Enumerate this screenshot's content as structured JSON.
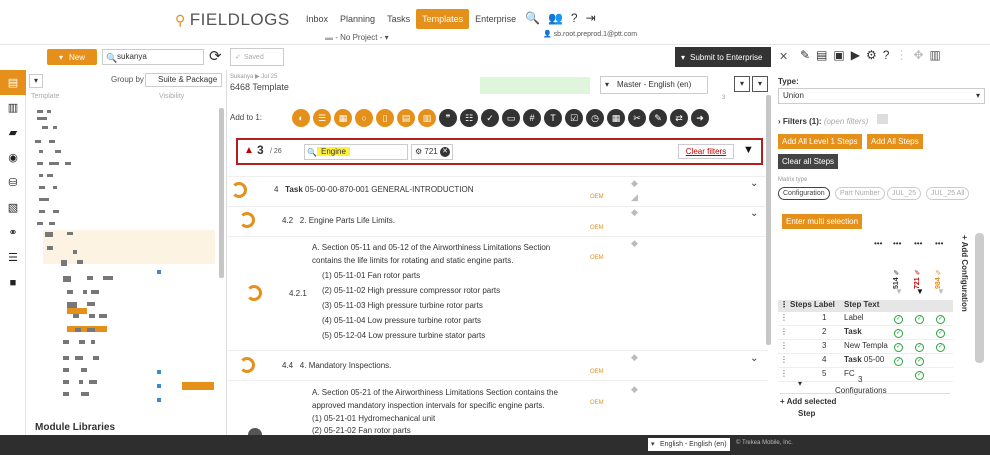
{
  "header": {
    "logo": "FIELDLOGS",
    "nav": [
      "Inbox",
      "Planning",
      "Tasks",
      "Templates",
      "Enterprise"
    ],
    "active_nav": "Templates",
    "project": "- No Project -",
    "user_email": "sb.root.preprod.1@ptt.com"
  },
  "toolbar": {
    "new_label": "New",
    "search_value": "sukanya",
    "saved_label": "Saved",
    "submit_label": "Submit to Enterprise"
  },
  "templates_panel": {
    "group_by_label": "Group by",
    "group_by_value": "Suite & Package",
    "col_template": "Template",
    "col_visibility": "Visibility",
    "module_libraries": "Module Libraries"
  },
  "content": {
    "breadcrumb": "Sukanya ▶ Jul 25",
    "template_name": "6468 Template",
    "language": "Master - English (en)",
    "page_indicator": "3",
    "add_to_label": "Add to 1:"
  },
  "filter_bar": {
    "count": "3",
    "total": "/ 26",
    "filter_text": "Engine",
    "chip_value": "721",
    "clear_label": "Clear filters"
  },
  "steps": [
    {
      "num": "4",
      "bold": "Task",
      "text": "05-00-00-870-001 GENERAL-INTRODUCTION",
      "oem": "OEM"
    },
    {
      "num": "4.2",
      "text": "2. Engine Parts Life Limits.",
      "oem": "OEM"
    },
    {
      "num": "4.2.1",
      "lines": [
        "A. Section 05-11 and 05-12 of the Airworthiness Limitations Section",
        "contains the life limits for rotating and static engine parts.",
        "(1) 05-11-01 Fan rotor parts",
        "(2) 05-11-02 High pressure compressor rotor parts",
        "(3) 05-11-03 High pressure turbine rotor parts",
        "(4) 05-11-04 Low pressure turbine rotor parts",
        "(5) 05-12-04 Low pressure turbine stator parts"
      ],
      "oem": "OEM"
    },
    {
      "num": "4.4",
      "text": "4. Mandatory Inspections.",
      "oem": "OEM"
    },
    {
      "num": "",
      "lines": [
        "A. Section 05-21 of the Airworthiness Limitations Section contains the",
        "approved mandatory inspection intervals for specific engine parts.",
        "(1) 05-21-01 Hydromechanical unit",
        "(2) 05-21-02 Fan rotor parts"
      ],
      "oem": "OEM"
    }
  ],
  "right_panel": {
    "type_label": "Type:",
    "type_value": "Union",
    "filters_label": "Filters (1):",
    "filters_hint": "(open filters)",
    "btn_add_level1": "Add All Level 1 Steps",
    "btn_add_all": "Add All Steps",
    "btn_clear_all": "Clear all Steps",
    "matrix_type_label": "Matrix type",
    "matrix_types": [
      "Configuration",
      "Part Number",
      "JUL_25",
      "JUL_25 All"
    ],
    "enter_multi": "Enter multi selection",
    "config_cols": [
      {
        "label": "514",
        "color": "#333333"
      },
      {
        "label": "721",
        "color": "#c20000"
      },
      {
        "label": "984",
        "color": "#e5901a"
      }
    ],
    "col_steps_label": "Steps Label",
    "col_step_text": "Step Text",
    "rows": [
      {
        "label": "1",
        "text": "Label",
        "checks": [
          true,
          true,
          true
        ]
      },
      {
        "label": "2",
        "text": "Task",
        "checks": [
          true,
          false,
          true
        ]
      },
      {
        "label": "3",
        "text": "New Templa",
        "checks": [
          true,
          true,
          true
        ]
      },
      {
        "label": "4",
        "text": "Task 05-00",
        "checks": [
          true,
          true,
          false
        ]
      },
      {
        "label": "5",
        "text": "FC",
        "checks": [
          false,
          true,
          false
        ]
      }
    ],
    "configurations_count": "3",
    "configurations_label": "Configurations",
    "add_selected": "+ Add selected",
    "add_selected_2": "Step",
    "add_configuration": "+ Add Configuration"
  },
  "footer": {
    "language": "English - English (en)",
    "copyright": "© Trekea Mobile, Inc."
  }
}
